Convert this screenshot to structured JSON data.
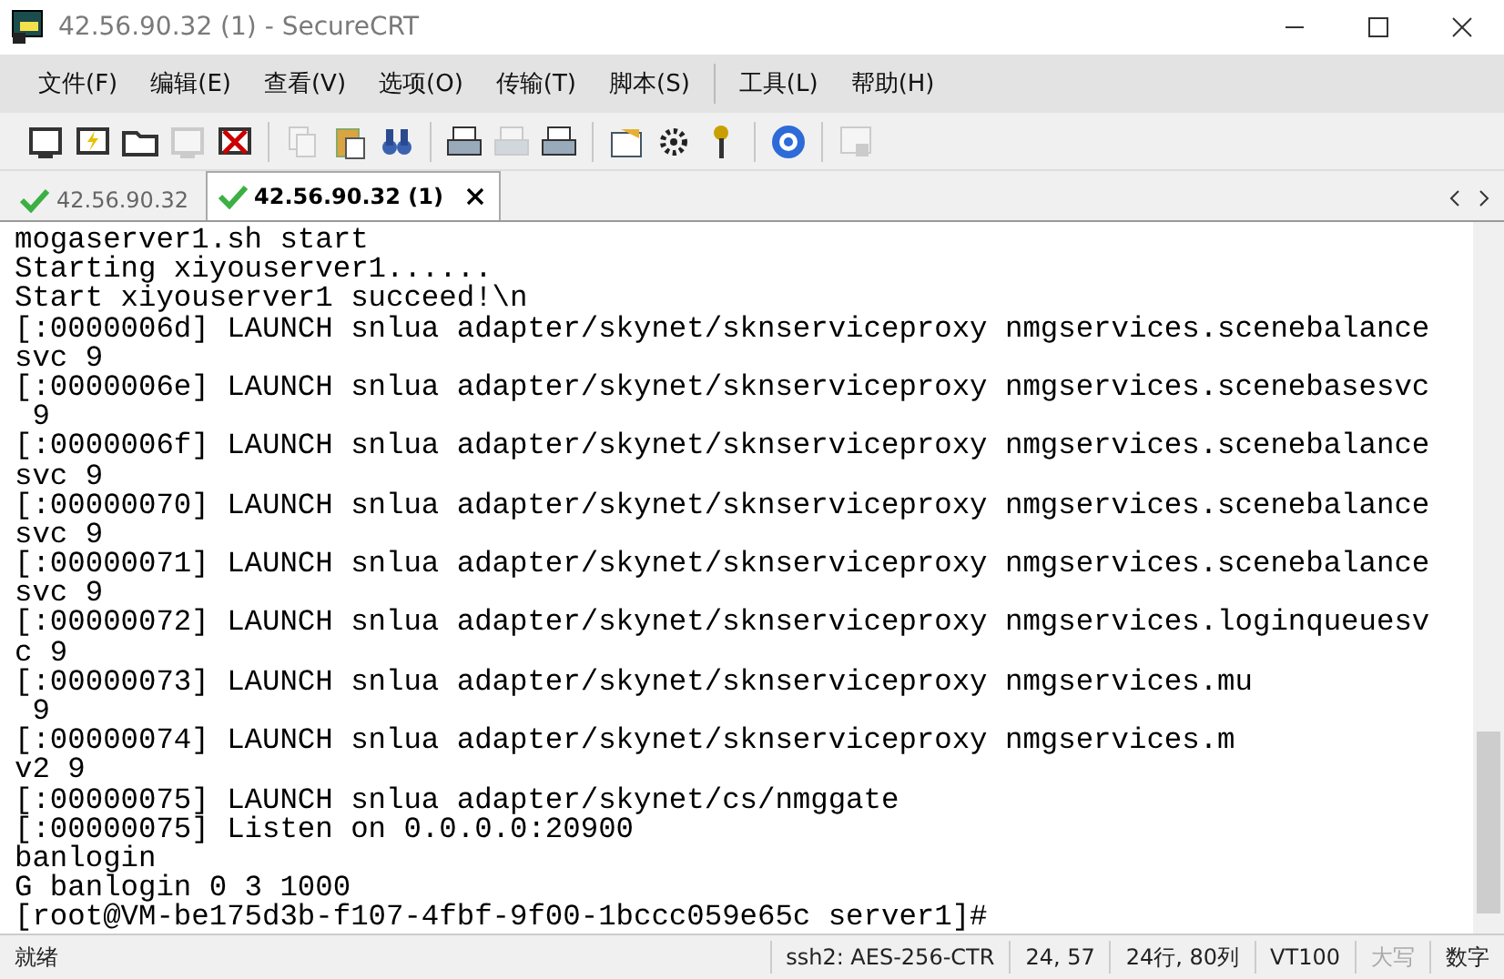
{
  "window": {
    "title": "42.56.90.32 (1) - SecureCRT"
  },
  "menu": [
    "文件(F)",
    "编辑(E)",
    "查看(V)",
    "选项(O)",
    "传输(T)",
    "脚本(S)",
    "工具(L)",
    "帮助(H)"
  ],
  "toolbar": [
    {
      "kind": "monitor",
      "disabled": false
    },
    {
      "kind": "bolt",
      "disabled": false
    },
    {
      "kind": "folder",
      "disabled": false
    },
    {
      "kind": "monitor",
      "disabled": true
    },
    {
      "kind": "cross",
      "disabled": false
    },
    {
      "kind": "separator"
    },
    {
      "kind": "copy",
      "disabled": true
    },
    {
      "kind": "clipboard",
      "disabled": false
    },
    {
      "kind": "binoculars",
      "disabled": false
    },
    {
      "kind": "separator"
    },
    {
      "kind": "printer",
      "disabled": false
    },
    {
      "kind": "printer",
      "disabled": true
    },
    {
      "kind": "printer",
      "disabled": false
    },
    {
      "kind": "separator"
    },
    {
      "kind": "form",
      "disabled": false
    },
    {
      "kind": "gear",
      "disabled": false
    },
    {
      "kind": "key",
      "disabled": false
    },
    {
      "kind": "separator"
    },
    {
      "kind": "help",
      "disabled": false
    },
    {
      "kind": "separator"
    },
    {
      "kind": "lock",
      "disabled": true
    }
  ],
  "tabs": [
    {
      "label": "42.56.90.32",
      "selected": false
    },
    {
      "label": "42.56.90.32 (1)",
      "selected": true
    }
  ],
  "terminal": {
    "lines": [
      "mogaserver1.sh start",
      "Starting xiyouserver1......",
      "Start xiyouserver1 succeed!\\n",
      "[:0000006d] LAUNCH snlua adapter/skynet/sknserviceproxy nmgservices.scenebalance",
      "svc 9",
      "[:0000006e] LAUNCH snlua adapter/skynet/sknserviceproxy nmgservices.scenebasesvc",
      " 9",
      "[:0000006f] LAUNCH snlua adapter/skynet/sknserviceproxy nmgservices.scenebalance",
      "svc 9",
      "[:00000070] LAUNCH snlua adapter/skynet/sknserviceproxy nmgservices.scenebalance",
      "svc 9",
      "[:00000071] LAUNCH snlua adapter/skynet/sknserviceproxy nmgservices.scenebalance",
      "svc 9",
      "[:00000072] LAUNCH snlua adapter/skynet/sknserviceproxy nmgservices.loginqueuesv",
      "c 9",
      "[:00000073] LAUNCH snlua adapter/skynet/sknserviceproxy nmgservices.mu",
      " 9",
      "[:00000074] LAUNCH snlua adapter/skynet/sknserviceproxy nmgservices.m",
      "v2 9",
      "[:00000075] LAUNCH snlua adapter/skynet/cs/nmggate",
      "[:00000075] Listen on 0.0.0.0:20900",
      "banlogin",
      "G banlogin 0 3 1000",
      "[root@VM-be175d3b-f107-4fbf-9f00-1bccc059e65c server1]#"
    ]
  },
  "status_bar": [
    "就绪",
    "ssh2: AES-256-CTR",
    "24,  57",
    "24行, 80列",
    "VT100",
    "大写",
    "数字"
  ]
}
